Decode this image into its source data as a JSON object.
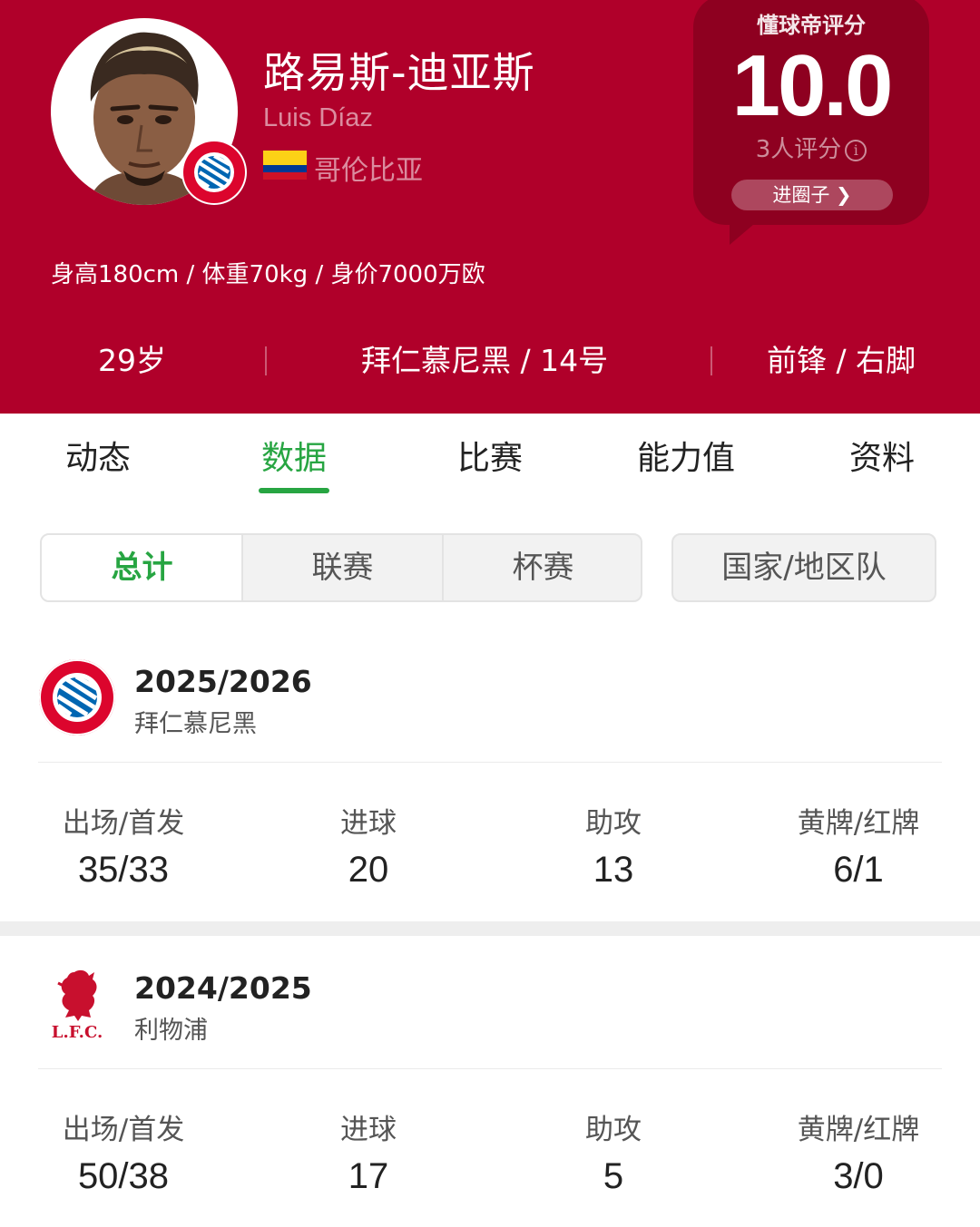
{
  "player": {
    "name_cn": "路易斯-迪亚斯",
    "name_en": "Luis Díaz",
    "country": "哥伦比亚",
    "body_stats": "身高180cm / 体重70kg / 身价7000万欧",
    "age": "29岁",
    "club_number": "拜仁慕尼黑 / 14号",
    "position_foot": "前锋 / 右脚"
  },
  "rating": {
    "title": "懂球帝评分",
    "score": "10.0",
    "count": "3人评分",
    "info_icon": "i",
    "button": "进圈子 ❯"
  },
  "tabs": [
    "动态",
    "数据",
    "比赛",
    "能力值",
    "资料"
  ],
  "active_tab": "数据",
  "filters": {
    "segments": [
      "总计",
      "联赛",
      "杯赛"
    ],
    "active": "总计",
    "national": "国家/地区队"
  },
  "seasons": [
    {
      "year": "2025/2026",
      "club": "拜仁慕尼黑",
      "logo": "bayern-logo-icon",
      "stats": [
        {
          "label": "出场/首发",
          "value": "35/33"
        },
        {
          "label": "进球",
          "value": "20"
        },
        {
          "label": "助攻",
          "value": "13"
        },
        {
          "label": "黄牌/红牌",
          "value": "6/1"
        }
      ]
    },
    {
      "year": "2024/2025",
      "club": "利物浦",
      "logo": "liverpool-logo-icon",
      "stats": [
        {
          "label": "出场/首发",
          "value": "50/38"
        },
        {
          "label": "进球",
          "value": "17"
        },
        {
          "label": "助攻",
          "value": "5"
        },
        {
          "label": "黄牌/红牌",
          "value": "3/0"
        }
      ]
    }
  ],
  "colors": {
    "header_bg": "#b0002a",
    "rating_bg": "#8e0020",
    "accent_green": "#27a542"
  }
}
